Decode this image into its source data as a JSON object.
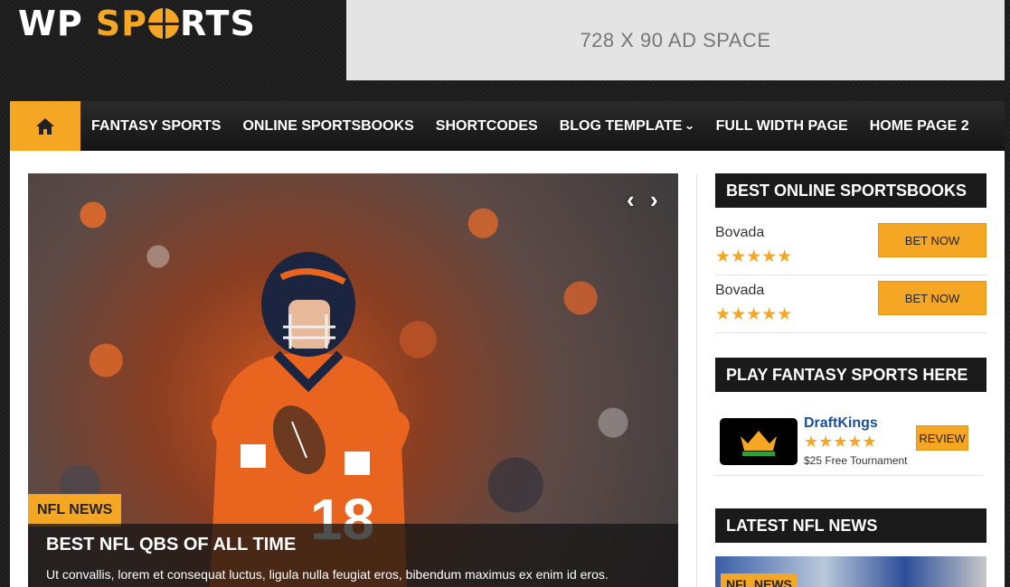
{
  "logo": {
    "word1": "WP",
    "word2_pre": "SP",
    "word2_post": "RTS"
  },
  "ad": {
    "label": "728 X 90 AD SPACE"
  },
  "nav": {
    "items": [
      "FANTASY SPORTS",
      "ONLINE SPORTSBOOKS",
      "SHORTCODES",
      "BLOG TEMPLATE",
      "FULL WIDTH PAGE",
      "HOME PAGE 2"
    ]
  },
  "slider": {
    "category": "NFL NEWS",
    "title": "BEST NFL QBS OF ALL TIME",
    "excerpt": "Ut convallis, lorem et consequat luctus, ligula nulla feugiat eros, bibendum maximus ex enim id eros.",
    "jersey_number": "18"
  },
  "sidebar": {
    "sportsbooks_title": "BEST ONLINE SPORTSBOOKS",
    "sportsbooks": [
      {
        "name": "Bovada",
        "rating": 5,
        "button": "BET NOW"
      },
      {
        "name": "Bovada",
        "rating": 5,
        "button": "BET NOW"
      }
    ],
    "fantasy_title": "PLAY FANTASY SPORTS HERE",
    "fantasy": {
      "name": "DraftKings",
      "rating": 4.5,
      "subtitle": "$25 Free Tournament",
      "button": "REVIEW",
      "logo_text": "DRAFT KINGS"
    },
    "news_title": "LATEST NFL NEWS",
    "news_tag": "NFL NEWS"
  },
  "colors": {
    "accent": "#f5a623",
    "dark": "#1a1a1a",
    "link": "#1a4f9e"
  }
}
